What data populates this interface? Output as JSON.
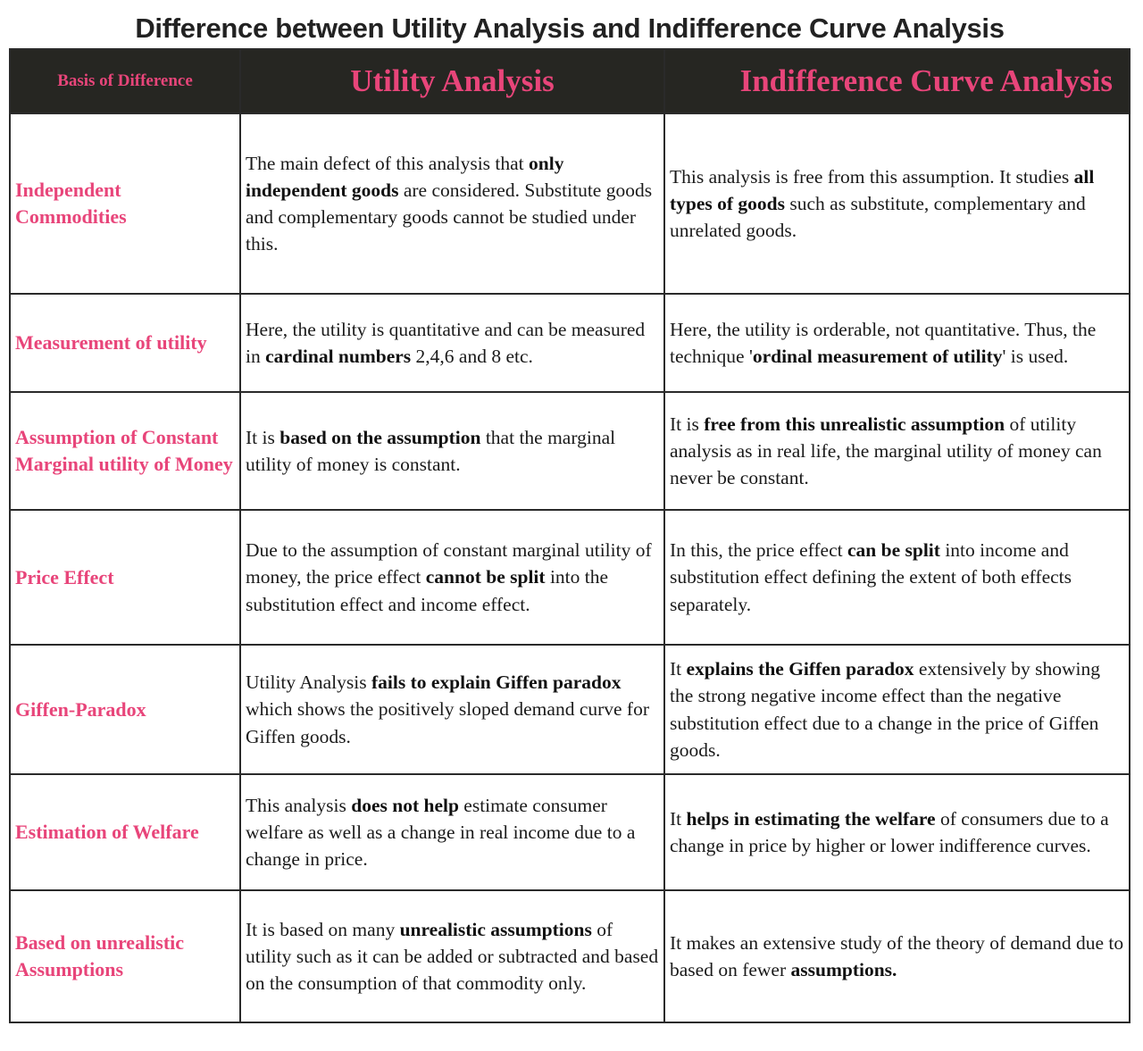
{
  "title": "Difference between Utility Analysis and Indifference Curve Analysis",
  "colors": {
    "accent_pink": "#e8457a",
    "header_background": "#262622",
    "border": "#2a2a2a",
    "body_text": "#1a1a1a"
  },
  "table": {
    "headers": {
      "basis": "Basis of Difference",
      "utility": "Utility Analysis",
      "indifference": "Indifference Curve Analysis"
    },
    "rows": [
      {
        "basis": "Independent Commodities",
        "utility": [
          {
            "t": "The main defect of this analysis that ",
            "b": false
          },
          {
            "t": "only independent goods",
            "b": true
          },
          {
            "t": " are considered. Substitute goods and complementary goods cannot be studied under this.",
            "b": false
          }
        ],
        "indifference": [
          {
            "t": "This analysis is free from this assumption. It studies ",
            "b": false
          },
          {
            "t": "all types of goods",
            "b": true
          },
          {
            "t": " such as substitute, complementary and unrelated goods.",
            "b": false
          }
        ]
      },
      {
        "basis": "Measurement of utility",
        "utility": [
          {
            "t": "Here, the utility is quantitative and can be measured in ",
            "b": false
          },
          {
            "t": "cardinal numbers",
            "b": true
          },
          {
            "t": " 2,4,6 and 8 etc.",
            "b": false
          }
        ],
        "indifference": [
          {
            "t": "Here, the utility is orderable, not quantitative. Thus, the technique '",
            "b": false
          },
          {
            "t": "ordinal measurement of utility",
            "b": true
          },
          {
            "t": "' is used.",
            "b": false
          }
        ]
      },
      {
        "basis": "Assumption of Constant Marginal utility of Money",
        "utility": [
          {
            "t": "It is ",
            "b": false
          },
          {
            "t": "based on the assumption",
            "b": true
          },
          {
            "t": " that the marginal utility of money is constant.",
            "b": false
          }
        ],
        "indifference": [
          {
            "t": "It is ",
            "b": false
          },
          {
            "t": "free from this unrealistic assumption",
            "b": true
          },
          {
            "t": " of utility analysis as in real life, the marginal utility of money can never be constant.",
            "b": false
          }
        ]
      },
      {
        "basis": "Price Effect",
        "utility": [
          {
            "t": "Due to the assumption of constant marginal utility of money, the price effect ",
            "b": false
          },
          {
            "t": "cannot be split",
            "b": true
          },
          {
            "t": " into the substitution effect and income effect.",
            "b": false
          }
        ],
        "indifference": [
          {
            "t": "In this, the price effect ",
            "b": false
          },
          {
            "t": "can be split",
            "b": true
          },
          {
            "t": " into income and substitution effect defining the extent of both effects separately.",
            "b": false
          }
        ]
      },
      {
        "basis": "Giffen-Paradox",
        "utility": [
          {
            "t": "Utility Analysis ",
            "b": false
          },
          {
            "t": "fails to explain Giffen paradox",
            "b": true
          },
          {
            "t": " which shows the positively sloped demand curve for Giffen goods.",
            "b": false
          }
        ],
        "indifference": [
          {
            "t": "It ",
            "b": false
          },
          {
            "t": "explains the Giffen paradox",
            "b": true
          },
          {
            "t": " extensively by showing the strong negative income effect than the negative substitution effect due to a change in the price of Giffen goods.",
            "b": false
          }
        ]
      },
      {
        "basis": "Estimation of Welfare",
        "utility": [
          {
            "t": "This analysis ",
            "b": false
          },
          {
            "t": "does not help",
            "b": true
          },
          {
            "t": " estimate consumer welfare as well as a change in real income due to a change in price.",
            "b": false
          }
        ],
        "indifference": [
          {
            "t": "It ",
            "b": false
          },
          {
            "t": "helps in estimating the welfare",
            "b": true
          },
          {
            "t": " of consumers due to a change in price by higher or lower indifference curves.",
            "b": false
          }
        ]
      },
      {
        "basis": "Based on unrealistic Assumptions",
        "utility": [
          {
            "t": "It is based on many ",
            "b": false
          },
          {
            "t": "unrealistic assumptions",
            "b": true
          },
          {
            "t": " of utility such as it can be added or subtracted and based on the consumption of that commodity only.",
            "b": false
          }
        ],
        "indifference": [
          {
            "t": "It makes an extensive study of the theory of demand due to based on fewer ",
            "b": false
          },
          {
            "t": "assumptions.",
            "b": true
          }
        ]
      }
    ]
  }
}
